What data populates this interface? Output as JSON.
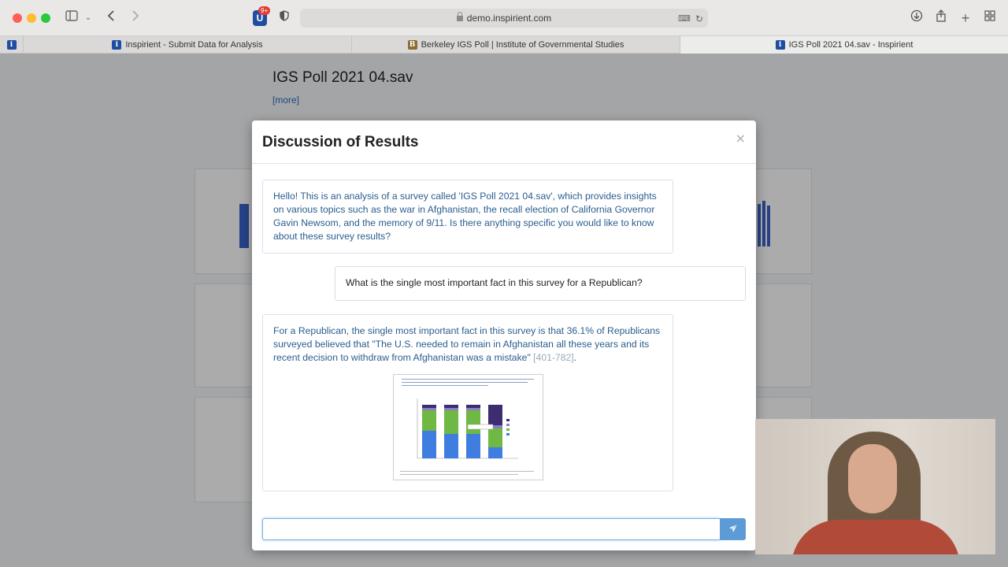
{
  "browser": {
    "url": "demo.inspirient.com",
    "extension_badge_count": "9+",
    "tabs": [
      {
        "title": "Inspirient - Submit Data for Analysis",
        "active": false,
        "favicon": "inspirient-icon"
      },
      {
        "title": "Berkeley IGS Poll | Institute of Governmental Studies",
        "active": false,
        "favicon": "igs-icon"
      },
      {
        "title": "IGS Poll 2021 04.sav - Inspirient",
        "active": true,
        "favicon": "inspirient-icon"
      }
    ]
  },
  "page": {
    "title": "IGS Poll 2021 04.sav",
    "more_link": "[more]"
  },
  "modal": {
    "title": "Discussion of Results",
    "close_label": "×",
    "messages": [
      {
        "role": "assistant",
        "text": "Hello! This is an analysis of a survey called 'IGS Poll 2021 04.sav', which provides insights on various topics such as the war in Afghanistan, the recall election of California Governor Gavin Newsom, and the memory of 9/11. Is there anything specific you would like to know about these survey results?"
      },
      {
        "role": "user",
        "text": "What is the single most important fact in this survey for a Republican?"
      },
      {
        "role": "assistant",
        "text": "For a Republican, the single most important fact in this survey is that 36.1% of Republicans surveyed believed that \"The U.S. needed to remain in Afghanistan all these years and its recent decision to withdraw from Afghanistan was a mistake\"",
        "citation": "[401-782]",
        "suffix": "."
      }
    ],
    "input_value": "",
    "send_icon": "paper-plane-icon"
  },
  "colors": {
    "accent": "#5d9bd6",
    "assistant_text": "#2a5d8f"
  }
}
